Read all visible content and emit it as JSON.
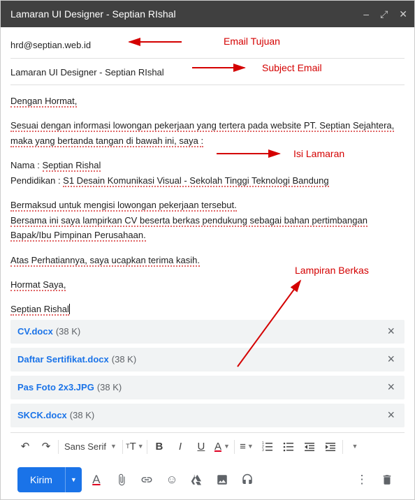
{
  "header": {
    "title": "Lamaran UI Designer - Septian RIshal"
  },
  "fields": {
    "to": "hrd@septian.web.id",
    "subject": "Lamaran UI Designer - Septian RIshal"
  },
  "body": {
    "salutation": "Dengan Hormat,",
    "p1_a": "Sesuai dengan informasi lowongan pekerjaan yang tertera pada website PT. Septian Sejahtera, maka yang bertanda tangan di bawah ini, saya :",
    "name_label": "Nama : ",
    "name_value": "Septian Rishal",
    "edu_label": "Pendidikan : ",
    "edu_value": "S1 Desain Komunikasi Visual - Sekolah Tinggi Teknologi Bandung",
    "p2": "Bermaksud untuk mengisi lowongan pekerjaan tersebut.",
    "p3": "Bersama ini saya lampirkan CV beserta berkas pendukung sebagai bahan pertimbangan Bapak/Ibu Pimpinan Perusahaan.",
    "p4": "Atas Perhatiannya, saya ucapkan terima kasih.",
    "closing": "Hormat Saya,",
    "sign": "Septian Rishal"
  },
  "attachments": [
    {
      "name": "CV.docx",
      "size": "(38 K)"
    },
    {
      "name": "Daftar Sertifikat.docx",
      "size": "(38 K)"
    },
    {
      "name": "Pas Foto 2x3.JPG",
      "size": "(38 K)"
    },
    {
      "name": "SKCK.docx",
      "size": "(38 K)"
    }
  ],
  "toolbar": {
    "font": "Sans Serif"
  },
  "actions": {
    "send": "Kirim"
  },
  "annotations": {
    "to": "Email Tujuan",
    "subject": "Subject Email",
    "body": "Isi Lamaran",
    "attach": "Lampiran Berkas"
  }
}
